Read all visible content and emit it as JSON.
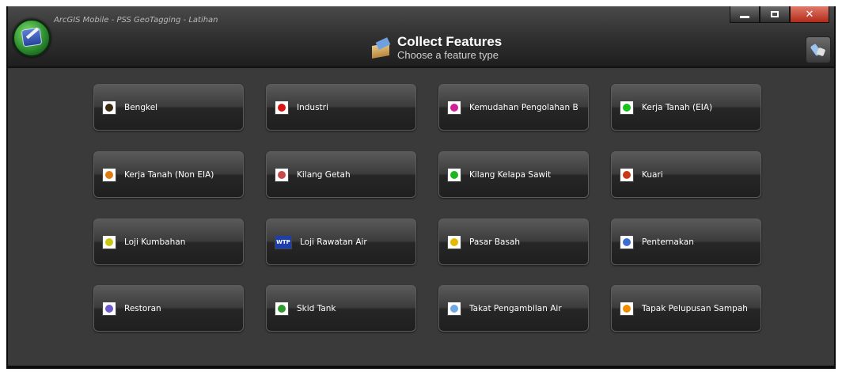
{
  "window": {
    "title": "ArcGIS Mobile - PSS GeoTagging - Latihan",
    "controls": {
      "minimize": "minimize-icon",
      "restore": "restore-icon",
      "close": "close-icon"
    }
  },
  "header": {
    "title": "Collect Features",
    "subtitle": "Choose a feature type",
    "icon": "package-icon",
    "tool_icon": "tools-icon"
  },
  "features": [
    {
      "label": "Bengkel",
      "icon": "bengkel-icon",
      "color": "#3b2b10"
    },
    {
      "label": "Industri",
      "icon": "industri-icon",
      "color": "#d81414"
    },
    {
      "label": "Kemudahan Pengolahan B",
      "icon": "kemudahan-icon",
      "color": "#d0209a"
    },
    {
      "label": "Kerja Tanah (EIA)",
      "icon": "kerja-tanah-eia-icon",
      "color": "#19c21f"
    },
    {
      "label": "Kerja Tanah (Non EIA)",
      "icon": "kerja-tanah-non-eia-icon",
      "color": "#e07a12"
    },
    {
      "label": "Kilang Getah",
      "icon": "kilang-getah-icon",
      "color": "#c64a4a"
    },
    {
      "label": "Kilang Kelapa Sawit",
      "icon": "kilang-kelapa-sawit-icon",
      "color": "#1fb51f"
    },
    {
      "label": "Kuari",
      "icon": "kuari-icon",
      "color": "#c53b1a"
    },
    {
      "label": "Loji Kumbahan",
      "icon": "loji-kumbahan-icon",
      "color": "#c9c812"
    },
    {
      "label": "Loji Rawatan Air",
      "icon": "wtp-icon",
      "color": "#1f3fa8",
      "text": "WTP"
    },
    {
      "label": "Pasar Basah",
      "icon": "pasar-basah-icon",
      "color": "#e6b800"
    },
    {
      "label": "Penternakan",
      "icon": "penternakan-icon",
      "color": "#3a6fd0"
    },
    {
      "label": "Restoran",
      "icon": "restoran-icon",
      "color": "#6a5acd"
    },
    {
      "label": "Skid Tank",
      "icon": "skid-tank-icon",
      "color": "#2e9a2e"
    },
    {
      "label": "Takat Pengambilan Air",
      "icon": "takat-pengambilan-air-icon",
      "color": "#6fa8e6"
    },
    {
      "label": "Tapak Pelupusan Sampah",
      "icon": "tapak-pelupusan-sampah-icon",
      "color": "#f08c00"
    }
  ]
}
